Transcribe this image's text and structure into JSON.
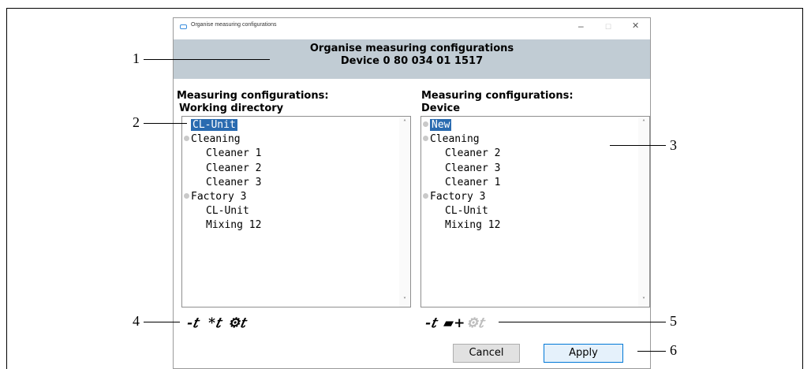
{
  "window": {
    "title": "Organise measuring configurations",
    "min_glyph": "–",
    "max_glyph": "☐",
    "close_glyph": "✕"
  },
  "header": {
    "line1": "Organise measuring configurations",
    "line2": "Device 0 80 034 01 1517"
  },
  "left_panel": {
    "heading_line1": "Measuring configurations:",
    "heading_line2": "Working directory",
    "items": [
      {
        "label": "CL-Unit",
        "level": 0,
        "dot": false,
        "selected": true
      },
      {
        "label": "Cleaning",
        "level": 0,
        "dot": true,
        "selected": false
      },
      {
        "label": "Cleaner 1",
        "level": 1,
        "dot": false,
        "selected": false
      },
      {
        "label": "Cleaner 2",
        "level": 1,
        "dot": false,
        "selected": false
      },
      {
        "label": "Cleaner 3",
        "level": 1,
        "dot": false,
        "selected": false
      },
      {
        "label": "Factory 3",
        "level": 0,
        "dot": true,
        "selected": false
      },
      {
        "label": "CL-Unit",
        "level": 1,
        "dot": false,
        "selected": false
      },
      {
        "label": "Mixing 12",
        "level": 1,
        "dot": false,
        "selected": false
      }
    ],
    "tools": [
      {
        "name": "remove-config-icon",
        "glyph": "-𝑡",
        "disabled": false
      },
      {
        "name": "new-config-icon",
        "glyph": "*𝑡",
        "disabled": false
      },
      {
        "name": "settings-config-icon",
        "glyph": "⚙𝑡",
        "disabled": false
      }
    ]
  },
  "right_panel": {
    "heading_line1": "Measuring configurations:",
    "heading_line2": "Device",
    "items": [
      {
        "label": "New",
        "level": 0,
        "dot": true,
        "selected": true
      },
      {
        "label": "Cleaning",
        "level": 0,
        "dot": true,
        "selected": false
      },
      {
        "label": "Cleaner 2",
        "level": 1,
        "dot": false,
        "selected": false
      },
      {
        "label": "Cleaner 3",
        "level": 1,
        "dot": false,
        "selected": false
      },
      {
        "label": "Cleaner 1",
        "level": 1,
        "dot": false,
        "selected": false
      },
      {
        "label": "Factory 3",
        "level": 0,
        "dot": true,
        "selected": false
      },
      {
        "label": "CL-Unit",
        "level": 1,
        "dot": false,
        "selected": false
      },
      {
        "label": "Mixing 12",
        "level": 1,
        "dot": false,
        "selected": false
      }
    ],
    "tools": [
      {
        "name": "remove-config-icon",
        "glyph": "-𝑡",
        "disabled": false
      },
      {
        "name": "new-folder-icon",
        "glyph": "▰+",
        "disabled": false
      },
      {
        "name": "settings-config-icon",
        "glyph": "⚙𝑡",
        "disabled": true
      }
    ]
  },
  "buttons": {
    "cancel": "Cancel",
    "apply": "Apply"
  },
  "callouts": [
    "1",
    "2",
    "3",
    "4",
    "5",
    "6"
  ],
  "scroll_up": "˄",
  "scroll_down": "˅",
  "colors": {
    "header_bg": "#c1ccd4",
    "selection": "#2a6bb0",
    "apply_border": "#0078d7"
  }
}
